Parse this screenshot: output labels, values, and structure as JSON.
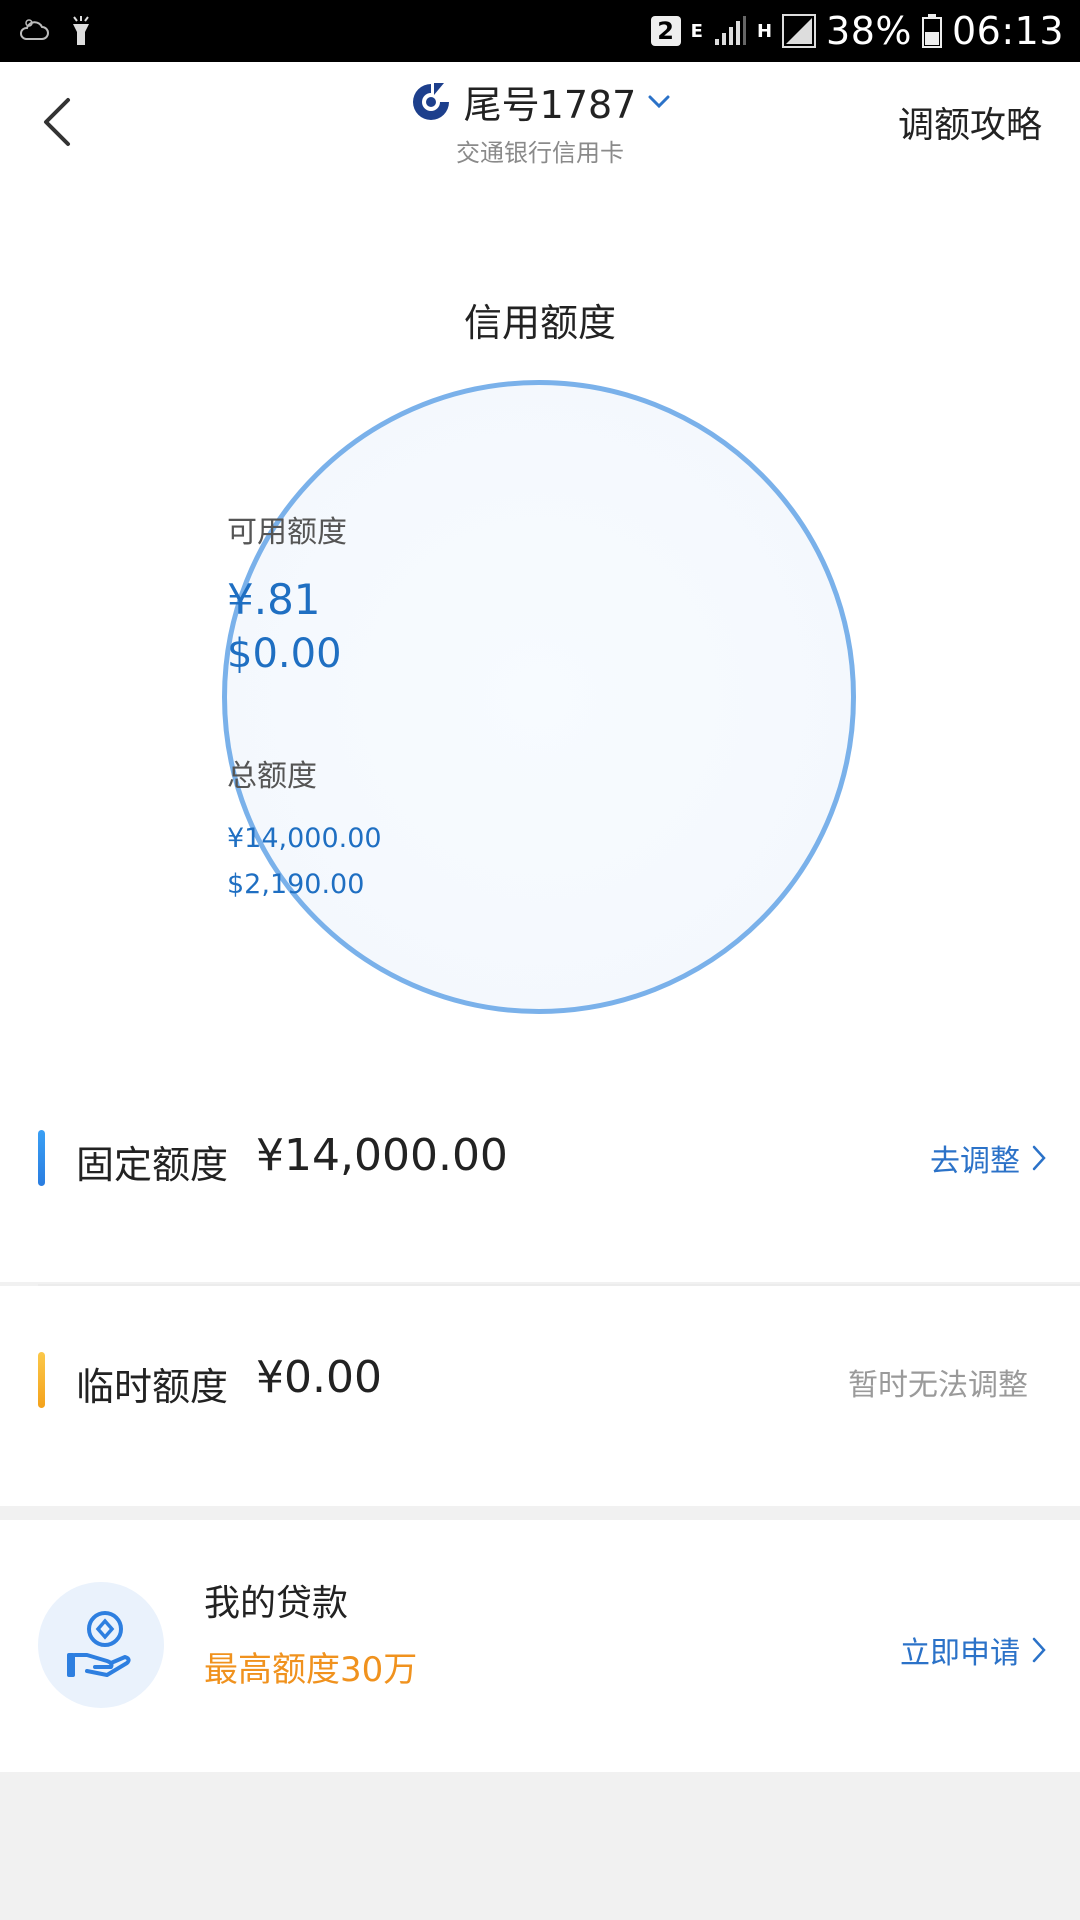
{
  "status_bar": {
    "sim_slot": "2",
    "network_e": "E",
    "network_h": "H",
    "battery_percent": "38%",
    "time": "06:13"
  },
  "header": {
    "card_title": "尾号1787",
    "card_subtitle": "交通银行信用卡",
    "strategy_label": "调额攻略"
  },
  "credit": {
    "section_title": "信用额度",
    "available_label": "可用额度",
    "available_cny": "¥.81",
    "available_usd": "$0.00",
    "total_label": "总额度",
    "total_cny": "¥14,000.00",
    "total_usd": "$2,190.00"
  },
  "fixed": {
    "label": "固定额度",
    "amount": "¥14,000.00",
    "action": "去调整",
    "bar_color": "#2e8cf0"
  },
  "temporary": {
    "label": "临时额度",
    "amount": "¥0.00",
    "status": "暂时无法调整",
    "bar_color": "#f7b32b"
  },
  "loan": {
    "title": "我的贷款",
    "subtitle": "最高额度30万",
    "action": "立即申请"
  },
  "colors": {
    "accent_blue": "#2b72c8",
    "orange": "#f0921e",
    "circle_border": "#7ab1ea"
  },
  "icons": {
    "back": "chevron-left-icon",
    "dropdown": "chevron-down-icon",
    "bank": "bank-logo-icon",
    "loan": "hand-coin-icon"
  }
}
